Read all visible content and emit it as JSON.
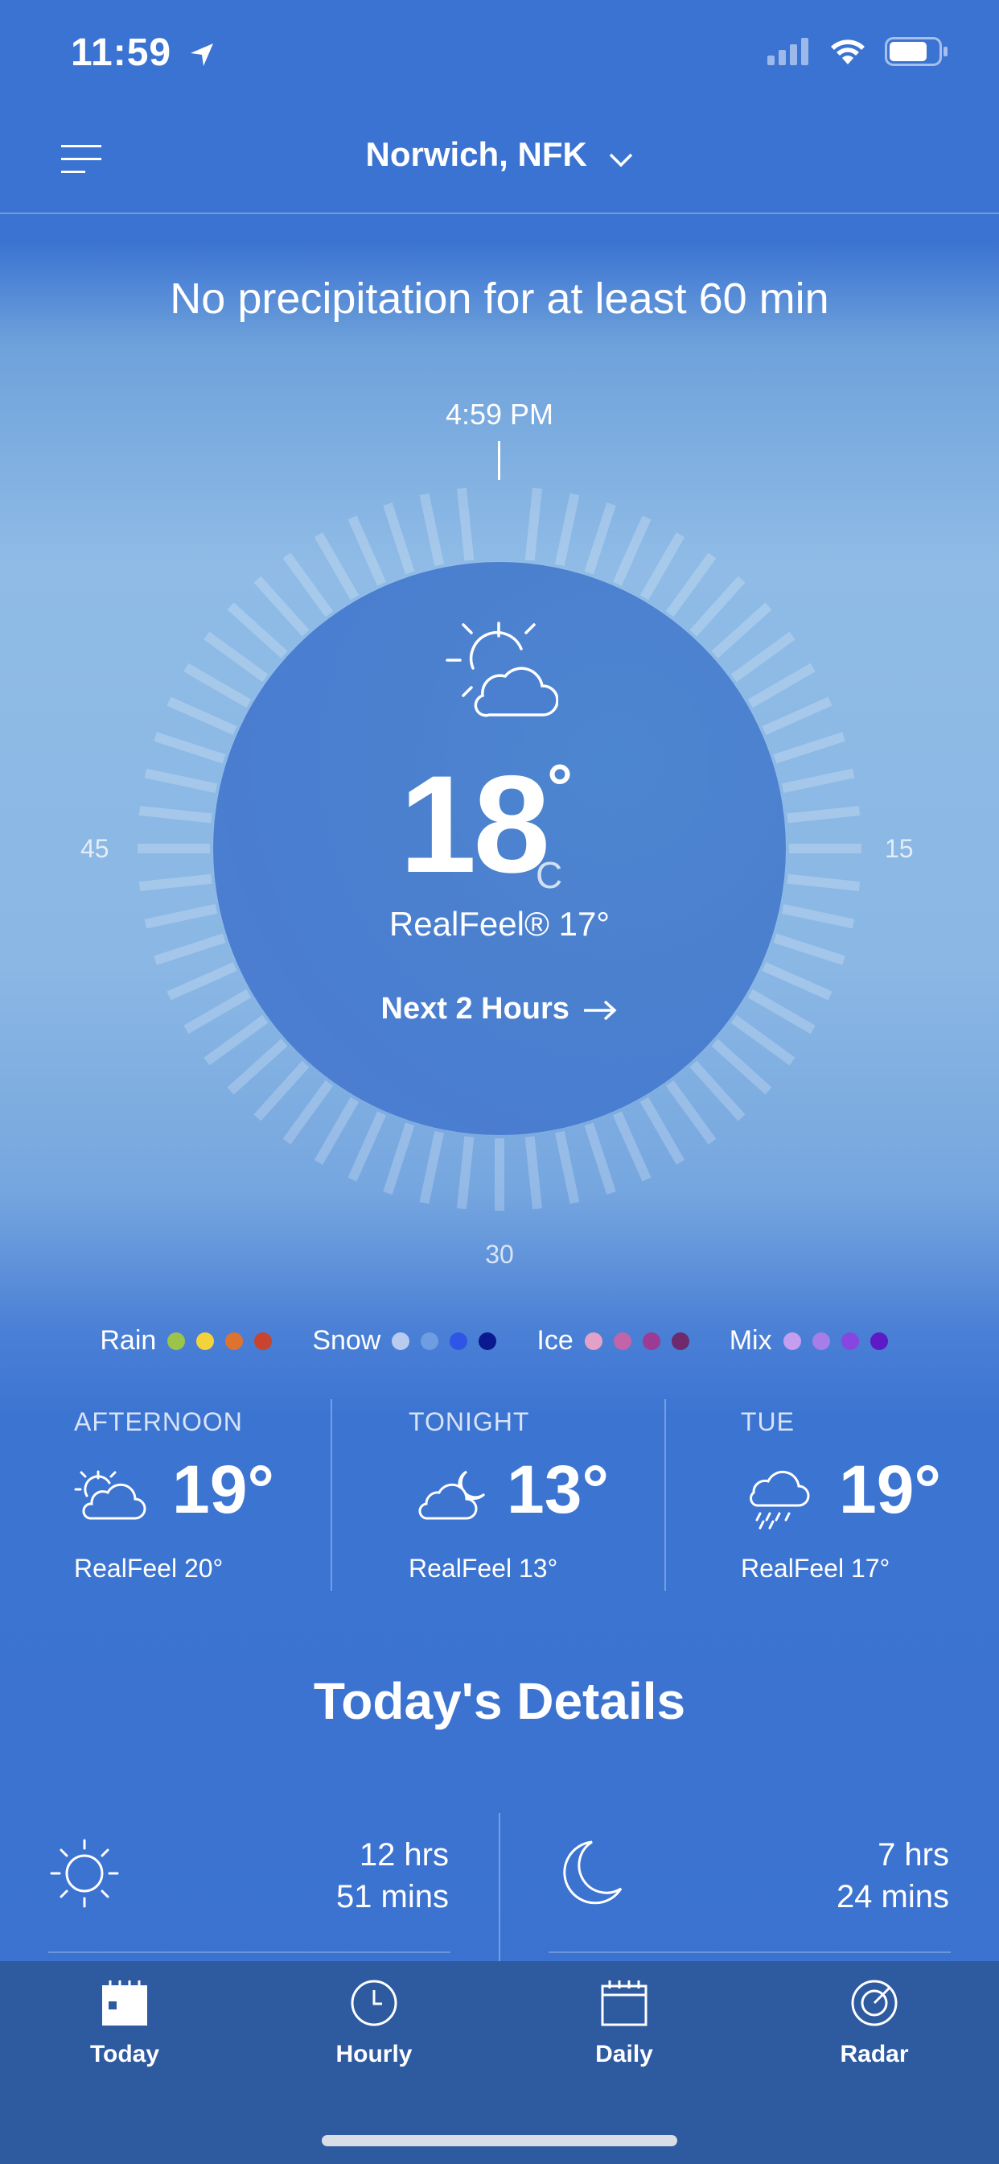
{
  "status": {
    "time": "11:59"
  },
  "header": {
    "location": "Norwich, NFK"
  },
  "now": {
    "precip_message": "No precipitation for at least 60 min",
    "timeline_time": "4:59 PM",
    "dial_labels": {
      "left": "45",
      "right": "15",
      "bottom": "30"
    },
    "temperature": "18",
    "degree": "°",
    "unit": "C",
    "realfeel": "RealFeel® 17°",
    "next_hours": "Next 2 Hours",
    "icon": "partly-sunny-icon"
  },
  "legend": [
    {
      "label": "Rain",
      "colors": [
        "#9cc44a",
        "#f3d23a",
        "#e0722f",
        "#c9442e"
      ]
    },
    {
      "label": "Snow",
      "colors": [
        "#b9ccef",
        "#6f9de3",
        "#2f55e6",
        "#0a1990"
      ]
    },
    {
      "label": "Ice",
      "colors": [
        "#e3a1c8",
        "#c165a8",
        "#9b3b93",
        "#6e2a6b"
      ]
    },
    {
      "label": "Mix",
      "colors": [
        "#c59ef0",
        "#a77de8",
        "#8846e0",
        "#5d1ac7"
      ]
    }
  ],
  "forecast": [
    {
      "title": "AFTERNOON",
      "temp": "19°",
      "realfeel": "RealFeel 20°",
      "icon": "partly-sunny-icon"
    },
    {
      "title": "TONIGHT",
      "temp": "13°",
      "realfeel": "RealFeel 13°",
      "icon": "partly-cloudy-night-icon"
    },
    {
      "title": "TUE",
      "temp": "19°",
      "realfeel": "RealFeel 17°",
      "icon": "rain-cloud-icon"
    }
  ],
  "details": {
    "title": "Today's Details",
    "sun": {
      "line1": "12 hrs",
      "line2": "51 mins",
      "icon": "sun-icon"
    },
    "moon": {
      "line1": "7 hrs",
      "line2": "24 mins",
      "icon": "moon-icon"
    }
  },
  "tabs": [
    {
      "label": "Today",
      "icon": "calendar-today-icon"
    },
    {
      "label": "Hourly",
      "icon": "clock-icon"
    },
    {
      "label": "Daily",
      "icon": "calendar-icon"
    },
    {
      "label": "Radar",
      "icon": "radar-icon"
    }
  ]
}
